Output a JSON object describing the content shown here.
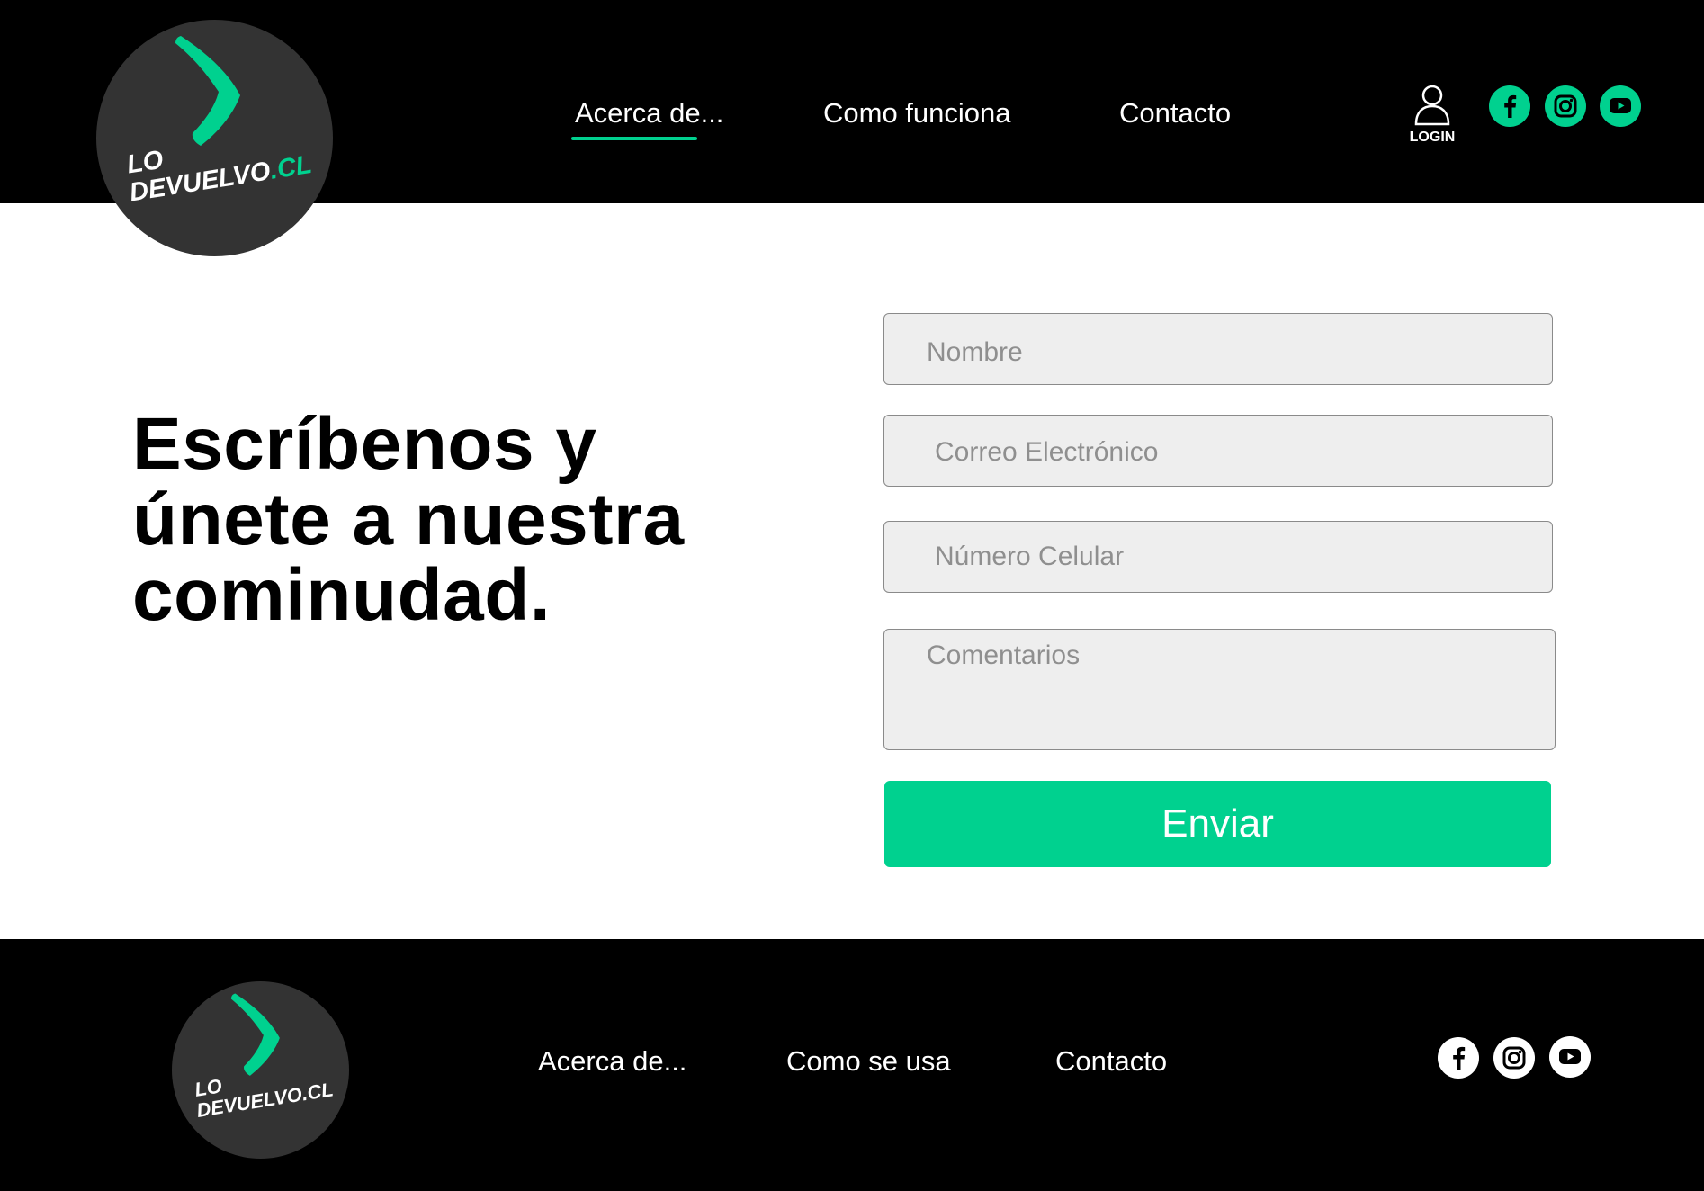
{
  "brand": {
    "logo_line1": "LO",
    "logo_line2": "DEVUELVO",
    "logo_suffix": ".CL",
    "accent_color": "#00d18f"
  },
  "header": {
    "nav": [
      {
        "label": "Acerca de...",
        "active": true
      },
      {
        "label": "Como funciona",
        "active": false
      },
      {
        "label": "Contacto",
        "active": false
      }
    ],
    "login_label": "LOGIN",
    "login_icon": "user-icon",
    "social_icons": [
      "facebook-icon",
      "instagram-icon",
      "youtube-icon"
    ]
  },
  "main": {
    "headline_lines": [
      "Escríbenos  y",
      "únete a nuestra",
      "cominudad."
    ],
    "form": {
      "name_placeholder": "Nombre",
      "email_placeholder": "Correo Electrónico",
      "phone_placeholder": "Número Celular",
      "comments_placeholder": "Comentarios",
      "submit_label": "Enviar"
    }
  },
  "footer": {
    "nav": [
      "Acerca de...",
      "Como se usa",
      "Contacto"
    ],
    "social_icons": [
      "facebook-icon",
      "instagram-icon",
      "youtube-icon"
    ]
  }
}
